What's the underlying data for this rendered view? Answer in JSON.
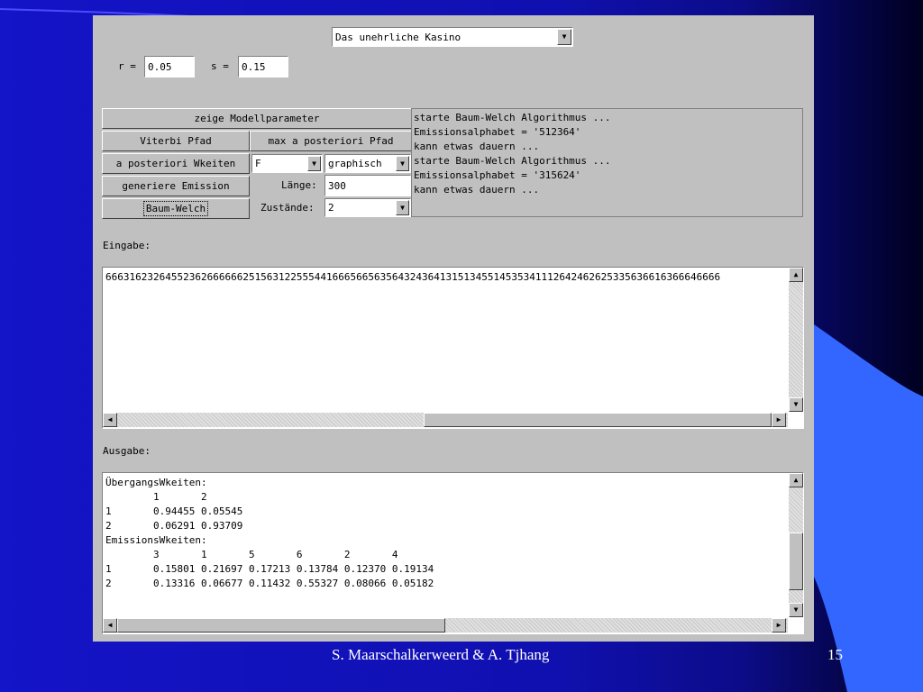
{
  "applet": {
    "model_select": {
      "value": "Das unehrliche Kasino",
      "arrow": "triangle-down-icon"
    },
    "r": {
      "label": "r =",
      "value": "0.05"
    },
    "s": {
      "label": "s =",
      "value": "0.15"
    },
    "buttons": {
      "show_params": "zeige Modellparameter",
      "viterbi": "Viterbi Pfad",
      "map_path": "max a posteriori Pfad",
      "posterior": "a posteriori Wkeiten",
      "generate": "generiere Emission",
      "baum_welch": "Baum-Welch"
    },
    "state_select": {
      "value": "F"
    },
    "display_select": {
      "value": "graphisch"
    },
    "length": {
      "label": "Länge:",
      "value": "300"
    },
    "states": {
      "label": "Zustände:",
      "value": "2"
    },
    "log": [
      "starte Baum-Welch Algorithmus ...",
      "Emissionsalphabet = '512364'",
      "kann etwas dauern ...",
      "starte Baum-Welch Algorithmus ...",
      "Emissionsalphabet = '315624'",
      "kann etwas dauern ..."
    ],
    "input_label": "Eingabe:",
    "input_text": "6663162326455236266666625156312255544166656656356432436413151345514535341112642462625335636616366646666",
    "output_label": "Ausgabe:",
    "output_lines": [
      "ÜbergangsWkeiten:",
      "        1       2",
      "1       0.94455 0.05545",
      "2       0.06291 0.93709",
      "",
      "EmissionsWkeiten:",
      "        3       1       5       6       2       4",
      "1       0.15801 0.21697 0.17213 0.13784 0.12370 0.19134",
      "2       0.13316 0.06677 0.11432 0.55327 0.08066 0.05182"
    ]
  },
  "footer": {
    "author": "S. Maarschalkerweerd & A. Tjhang",
    "page": "15"
  },
  "icons": {
    "scroll_up": "triangle-up-icon",
    "scroll_down": "triangle-down-icon",
    "scroll_left": "triangle-left-icon",
    "scroll_right": "triangle-right-icon"
  },
  "colors": {
    "background_blue": "#1414c8",
    "accent_blue": "#3366ff",
    "panel_gray": "#c0c0c0"
  }
}
